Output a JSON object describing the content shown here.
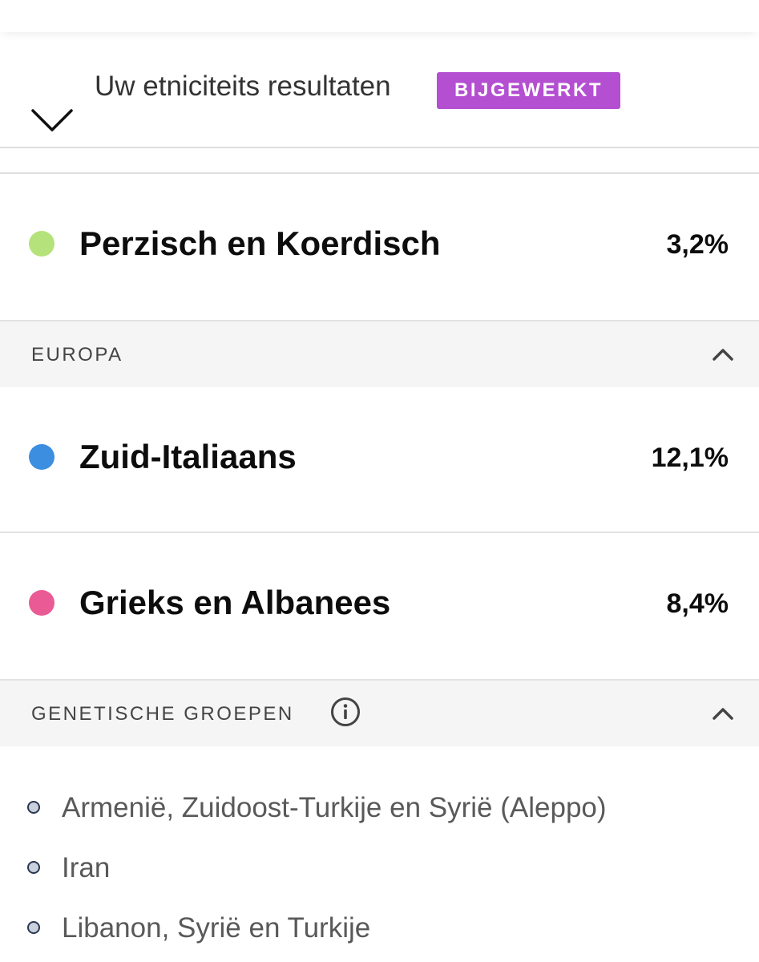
{
  "header": {
    "title": "Uw etniciteits resultaten",
    "badge": "BIJGEWERKT",
    "badge_color": "#b44fd2",
    "toggle_icon": "chevron-down-icon"
  },
  "ethnicities_top": [
    {
      "name": "Perzisch en Koerdisch",
      "percent": "3,2%",
      "color": "#b5e27a"
    }
  ],
  "sections": {
    "europa": {
      "label": "EUROPA",
      "toggle_icon": "chevron-up-icon",
      "items": [
        {
          "name": "Zuid-Italiaans",
          "percent": "12,1%",
          "color": "#3b8ee0"
        },
        {
          "name": "Grieks en Albanees",
          "percent": "8,4%",
          "color": "#ea5a95"
        }
      ]
    },
    "genetic_groups": {
      "label": "GENETISCHE GROEPEN",
      "info_icon": "info-icon",
      "toggle_icon": "chevron-up-icon",
      "items": [
        {
          "name": "Armenië, Zuidoost-Turkije en Syrië (Aleppo)"
        },
        {
          "name": "Iran"
        },
        {
          "name": "Libanon, Syrië en Turkije"
        }
      ]
    }
  }
}
